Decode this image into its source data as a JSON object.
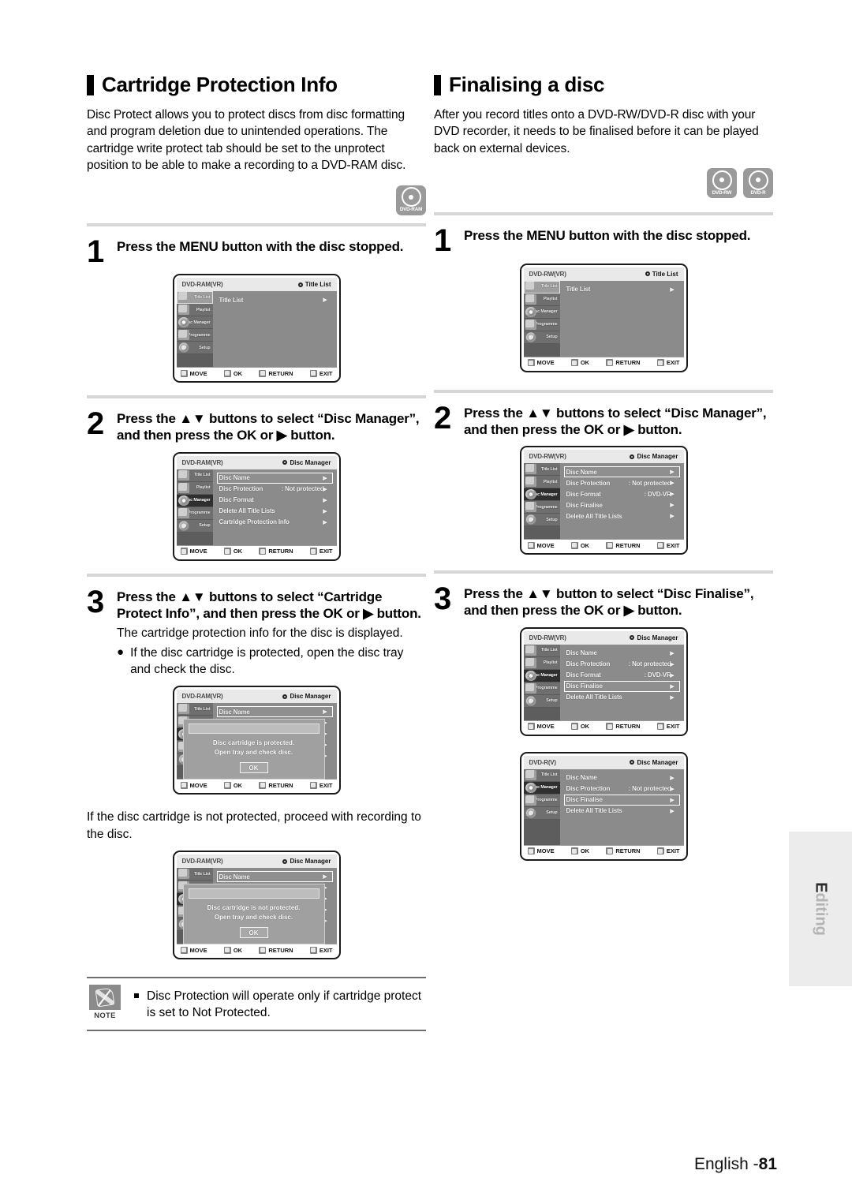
{
  "left": {
    "heading": "Cartridge Protection Info",
    "intro": "Disc Protect allows you to protect discs from disc formatting and program deletion due to unintended operations. The cartridge write protect tab should be set to the unprotect position to be able to make a recording to a DVD-RAM disc.",
    "badges": [
      {
        "label": "DVD-RAM"
      }
    ],
    "steps": [
      {
        "num": "1",
        "text": "Press the MENU button with the disc stopped."
      },
      {
        "num": "2",
        "text": "Press the ▲▼ buttons to select “Disc Manager”, and then press the OK or ▶ button."
      },
      {
        "num": "3",
        "text": "Press the ▲▼ buttons to select “Cartridge Protect Info”, and then press the OK or ▶ button.",
        "body": "The cartridge protection info for the disc is displayed.",
        "bullet": "If the disc cartridge is protected, open the disc tray and check the disc."
      }
    ],
    "after_text": "If the disc cartridge is not protected, proceed with recording to the disc."
  },
  "right": {
    "heading": "Finalising a disc",
    "intro": "After you record titles onto a DVD-RW/DVD-R disc with your DVD recorder, it needs to be finalised before it can be played back on external devices.",
    "badges": [
      {
        "label": "DVD-RW"
      },
      {
        "label": "DVD-R"
      }
    ],
    "steps": [
      {
        "num": "1",
        "text": "Press the MENU button with the disc stopped."
      },
      {
        "num": "2",
        "text": "Press the ▲▼ buttons to select “Disc Manager”, and then press the OK or ▶ button."
      },
      {
        "num": "3",
        "text": "Press the ▲▼ button to select “Disc Finalise”, and then press the OK or ▶ button."
      }
    ]
  },
  "osd_footer_keys": [
    {
      "label": "MOVE",
      "icon": "updown-key-icon"
    },
    {
      "label": "OK",
      "icon": "ok-key-icon"
    },
    {
      "label": "RETURN",
      "icon": "return-key-icon"
    },
    {
      "label": "EXIT",
      "icon": "exit-key-icon"
    }
  ],
  "sidebar_items_full": [
    {
      "label": "Title List",
      "icon": "title-list-icon"
    },
    {
      "label": "Playlist",
      "icon": "playlist-icon"
    },
    {
      "label": "Disc Manager",
      "icon": "disc-manager-icon"
    },
    {
      "label": "Programme",
      "icon": "programme-icon"
    },
    {
      "label": "Setup",
      "icon": "setup-gear-icon"
    }
  ],
  "sidebar_items_dvdr": [
    {
      "label": "Title List",
      "icon": "title-list-icon"
    },
    {
      "label": "Disc Manager",
      "icon": "disc-manager-icon"
    },
    {
      "label": "Programme",
      "icon": "programme-icon"
    },
    {
      "label": "Setup",
      "icon": "setup-gear-icon"
    }
  ],
  "screens": {
    "left1": {
      "disc": "DVD-RAM(VR)",
      "context": "Title List",
      "selected_sidebar": 0,
      "rows": [
        {
          "label": "Title List",
          "value": "",
          "highlight": false
        }
      ]
    },
    "left2": {
      "disc": "DVD-RAM(VR)",
      "context": "Disc Manager",
      "selected_sidebar": 2,
      "rows": [
        {
          "label": "Disc Name",
          "value": ":",
          "highlight": true
        },
        {
          "label": "Disc Protection",
          "value": ": Not protected",
          "highlight": false
        },
        {
          "label": "Disc Format",
          "value": "",
          "highlight": false
        },
        {
          "label": "Delete All Title Lists",
          "value": "",
          "highlight": false
        },
        {
          "label": "Cartridge Protection Info",
          "value": "",
          "highlight": false
        }
      ]
    },
    "left3": {
      "disc": "DVD-RAM(VR)",
      "context": "Disc Manager",
      "selected_sidebar": 2,
      "rows": [
        {
          "label": "Disc Name",
          "value": ":",
          "highlight": true
        },
        {
          "label": "Disc Protection",
          "value": ": Not protected",
          "highlight": false
        },
        {
          "label": "Disc Format",
          "value": "",
          "highlight": false
        },
        {
          "label": "Delete All Title Lists",
          "value": "",
          "highlight": false
        },
        {
          "label": "Cartridge Protection Info",
          "value": "",
          "highlight": false
        }
      ],
      "dialog": {
        "line1": "Disc cartridge is protected.",
        "line2": "Open tray and check disc.",
        "ok": "OK"
      }
    },
    "left4": {
      "disc": "DVD-RAM(VR)",
      "context": "Disc Manager",
      "selected_sidebar": 2,
      "rows": [
        {
          "label": "Disc Name",
          "value": ":",
          "highlight": true
        },
        {
          "label": "Disc Protection",
          "value": ": Not protected",
          "highlight": false
        },
        {
          "label": "Disc Format",
          "value": "",
          "highlight": false
        },
        {
          "label": "Delete All Title Lists",
          "value": "",
          "highlight": false
        },
        {
          "label": "Cartridge Protection Info",
          "value": "",
          "highlight": false
        }
      ],
      "dialog": {
        "line1": "Disc cartridge is not protected.",
        "line2": "Open tray and check disc.",
        "ok": "OK"
      }
    },
    "right1": {
      "disc": "DVD-RW(VR)",
      "context": "Title List",
      "selected_sidebar": 0,
      "rows": [
        {
          "label": "Title List",
          "value": "",
          "highlight": false
        }
      ]
    },
    "right2": {
      "disc": "DVD-RW(VR)",
      "context": "Disc Manager",
      "selected_sidebar": 2,
      "rows": [
        {
          "label": "Disc Name",
          "value": ":",
          "highlight": true
        },
        {
          "label": "Disc Protection",
          "value": ": Not protected",
          "highlight": false
        },
        {
          "label": "Disc Format",
          "value": ": DVD-VR",
          "highlight": false
        },
        {
          "label": "Disc Finalise",
          "value": "",
          "highlight": false
        },
        {
          "label": "Delete All Title Lists",
          "value": "",
          "highlight": false
        }
      ]
    },
    "right3": {
      "disc": "DVD-RW(VR)",
      "context": "Disc Manager",
      "selected_sidebar": 2,
      "rows": [
        {
          "label": "Disc Name",
          "value": ":",
          "highlight": false
        },
        {
          "label": "Disc Protection",
          "value": ": Not protected",
          "highlight": false
        },
        {
          "label": "Disc Format",
          "value": ": DVD-VR",
          "highlight": false
        },
        {
          "label": "Disc Finalise",
          "value": "",
          "highlight": true
        },
        {
          "label": "Delete All Title Lists",
          "value": "",
          "highlight": false
        }
      ]
    },
    "right4": {
      "disc": "DVD-R(V)",
      "context": "Disc Manager",
      "selected_sidebar": 1,
      "rows": [
        {
          "label": "Disc Name",
          "value": ":",
          "highlight": false
        },
        {
          "label": "Disc Protection",
          "value": ": Not protected",
          "highlight": false
        },
        {
          "label": "Disc Finalise",
          "value": "",
          "highlight": true
        },
        {
          "label": "Delete All Title Lists",
          "value": "",
          "highlight": false
        }
      ]
    }
  },
  "note": {
    "icon_label": "NOTE",
    "text": "Disc Protection will operate only if cartridge protect is set to Not Protected."
  },
  "side_tab": {
    "first": "E",
    "rest": "diting"
  },
  "footer": {
    "lang": "English -",
    "page": "81"
  }
}
